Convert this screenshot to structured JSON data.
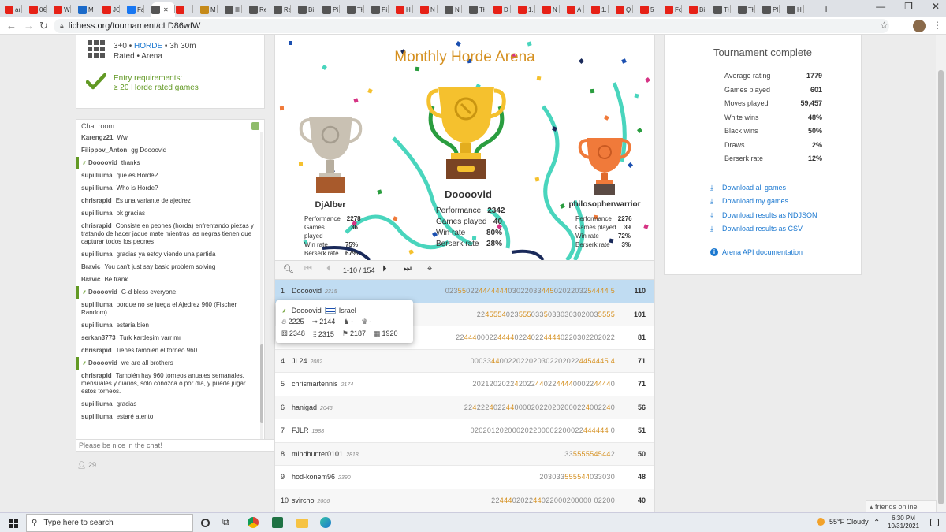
{
  "browser": {
    "tabs": [
      {
        "label": "ar",
        "color": "#e62117"
      },
      {
        "label": "0€",
        "color": "#e62117"
      },
      {
        "label": "W",
        "color": "#e62117"
      },
      {
        "label": "M",
        "color": "#1b6ac9"
      },
      {
        "label": "JC",
        "color": "#e62117"
      },
      {
        "label": "Fa",
        "color": "#1877f2"
      },
      {
        "label": "",
        "color": "#555555",
        "active": true
      },
      {
        "label": "",
        "color": "#e62117"
      },
      {
        "label": "M",
        "color": "#c58a1a"
      },
      {
        "label": "Ill",
        "color": "#555555"
      },
      {
        "label": "Re",
        "color": "#555555"
      },
      {
        "label": "Re",
        "color": "#555555"
      },
      {
        "label": "Bi",
        "color": "#555555"
      },
      {
        "label": "Pi",
        "color": "#555555"
      },
      {
        "label": "Tł",
        "color": "#555555"
      },
      {
        "label": "Pi",
        "color": "#555555"
      },
      {
        "label": "H",
        "color": "#e62117"
      },
      {
        "label": "N",
        "color": "#e62117"
      },
      {
        "label": "N",
        "color": "#555555"
      },
      {
        "label": "Tł",
        "color": "#555555"
      },
      {
        "label": "D",
        "color": "#e62117"
      },
      {
        "label": "1.",
        "color": "#e62117"
      },
      {
        "label": "N",
        "color": "#e62117"
      },
      {
        "label": "A",
        "color": "#e62117"
      },
      {
        "label": "1.",
        "color": "#e62117"
      },
      {
        "label": "Q",
        "color": "#e62117"
      },
      {
        "label": "5",
        "color": "#e62117"
      },
      {
        "label": "Fc",
        "color": "#e62117"
      },
      {
        "label": "Bi",
        "color": "#e62117"
      },
      {
        "label": "Tł",
        "color": "#555555"
      },
      {
        "label": "Tł",
        "color": "#555555"
      },
      {
        "label": "Pl",
        "color": "#555555"
      },
      {
        "label": "H",
        "color": "#555555"
      }
    ],
    "url": "lichess.org/tournament/cLD86wIW"
  },
  "setup": {
    "line1_prefix": "3+0 • ",
    "variant": "HORDE",
    "line1_suffix": " • 3h 30m",
    "line2": "Rated • Arena",
    "req_title": "Entry requirements:",
    "req_text": "≥ 20 Horde rated games"
  },
  "chat": {
    "title": "Chat room",
    "input_placeholder": "Please be nice in the chat!",
    "watchers": "29",
    "lines": [
      {
        "user": "Karengz21",
        "text": "Ww"
      },
      {
        "user": "Filippov_Anton",
        "text": "gg Doooovid"
      },
      {
        "user": "Doooovid",
        "text": "thanks",
        "hl": true
      },
      {
        "user": "supilliuma",
        "text": "que es Horde?"
      },
      {
        "user": "supilliuma",
        "text": "Who is Horde?"
      },
      {
        "user": "chrisrapid",
        "text": "Es una variante de ajedrez"
      },
      {
        "user": "supilliuma",
        "text": "ok gracias"
      },
      {
        "user": "chrisrapid",
        "text": "Consiste en peones (horda) enfrentando piezas y tratando de hacer jaque mate mientras las negras tienen que capturar todos los peones"
      },
      {
        "user": "supilliuma",
        "text": "gracias ya estoy viendo una partida"
      },
      {
        "user": "Bravic",
        "text": "You can't just say basic problem solving"
      },
      {
        "user": "Bravic",
        "text": "Be frank"
      },
      {
        "user": "Doooovid",
        "text": "G-d bless everyone!",
        "hl": true
      },
      {
        "user": "supilliuma",
        "text": "porque no se juega el Ajedrez 960 (Fischer Random)"
      },
      {
        "user": "supilliuma",
        "text": "estaria bien"
      },
      {
        "user": "serkan3773",
        "text": "Turk kardeşim varr mı"
      },
      {
        "user": "chrisrapid",
        "text": "Tienes tambien el torneo 960"
      },
      {
        "user": "Doooovid",
        "text": "we are all brothers",
        "hl": true
      },
      {
        "user": "chrisrapid",
        "text": "También hay 960 torneos anuales semanales, mensuales y diarios, solo conozca o por día, y puede jugar estos torneos."
      },
      {
        "user": "supilliuma",
        "text": "gracias"
      },
      {
        "user": "supilliuma",
        "text": "estaré atento"
      }
    ]
  },
  "podium": {
    "title": "Monthly Horde Arena",
    "labels": {
      "performance": "Performance",
      "games": "Games played",
      "winrate": "Win rate",
      "berserk": "Berserk rate"
    },
    "first": {
      "name": "Doooovid",
      "performance": "2342",
      "games": "40",
      "winrate": "80%",
      "berserk": "28%"
    },
    "second": {
      "name": "DjAlber",
      "performance": "2278",
      "games": "36",
      "winrate": "75%",
      "berserk": "67%"
    },
    "third": {
      "name": "philosopherwarrior",
      "performance": "2276",
      "games": "39",
      "winrate": "72%",
      "berserk": "3%"
    }
  },
  "controls": {
    "page": "1-10 / 154"
  },
  "standings": [
    {
      "rank": "1",
      "name": "Doooovid",
      "rating": "2315",
      "sheet": "023550224444444030220334450202203254444 5",
      "score": "110",
      "me": true
    },
    {
      "rank": "2",
      "name": "",
      "rating": "",
      "sheet": "224555402355503350330303020035555",
      "score": "101"
    },
    {
      "rank": "3",
      "name": "",
      "rating": "",
      "sheet": "22444000224444022402244440220302202022",
      "score": "81"
    },
    {
      "rank": "4",
      "name": "JL24",
      "rating": "2082",
      "sheet": "000334400220220203022020224454445 4",
      "score": "71"
    },
    {
      "rank": "5",
      "name": "chrismartennis",
      "rating": "2174",
      "sheet": "2021202022420224402244440002244440",
      "score": "71"
    },
    {
      "rank": "6",
      "name": "hanigad",
      "rating": "2046",
      "sheet": "224222402244000020220202000224002240",
      "score": "56"
    },
    {
      "rank": "7",
      "name": "FJLR",
      "rating": "1988",
      "sheet": "020201202000202200002200022444444 0",
      "score": "51"
    },
    {
      "rank": "8",
      "name": "mindhunter0101",
      "rating": "2818",
      "sheet": "335555545442",
      "score": "50"
    },
    {
      "rank": "9",
      "name": "hod-konem96",
      "rating": "2390",
      "sheet": "203033555544033030",
      "score": "48"
    },
    {
      "rank": "10",
      "name": "svircho",
      "rating": "2006",
      "sheet": "224440202244022000200000 02200",
      "score": "40"
    }
  ],
  "powertip": {
    "name": "Doooovid",
    "country": "Israel",
    "r1": [
      "2225",
      "2144",
      "-",
      "-"
    ],
    "r2": [
      "2348",
      "2315",
      "2187",
      "1920"
    ]
  },
  "summary": {
    "title": "Tournament complete",
    "stats": [
      {
        "label": "Average rating",
        "value": "1779"
      },
      {
        "label": "Games played",
        "value": "601"
      },
      {
        "label": "Moves played",
        "value": "59,457"
      },
      {
        "label": "White wins",
        "value": "48%"
      },
      {
        "label": "Black wins",
        "value": "50%"
      },
      {
        "label": "Draws",
        "value": "2%"
      },
      {
        "label": "Berserk rate",
        "value": "12%"
      }
    ],
    "downloads": [
      "Download all games",
      "Download my games",
      "Download results as NDJSON",
      "Download results as CSV"
    ],
    "api": "Arena API documentation"
  },
  "friends": "friends online",
  "taskbar": {
    "search": "Type here to search",
    "weather": "55°F  Cloudy",
    "time": "6:30 PM",
    "date": "10/31/2021"
  },
  "colors": {
    "accent": "#1b78d0",
    "green": "#629924",
    "gold": "#d59020"
  }
}
